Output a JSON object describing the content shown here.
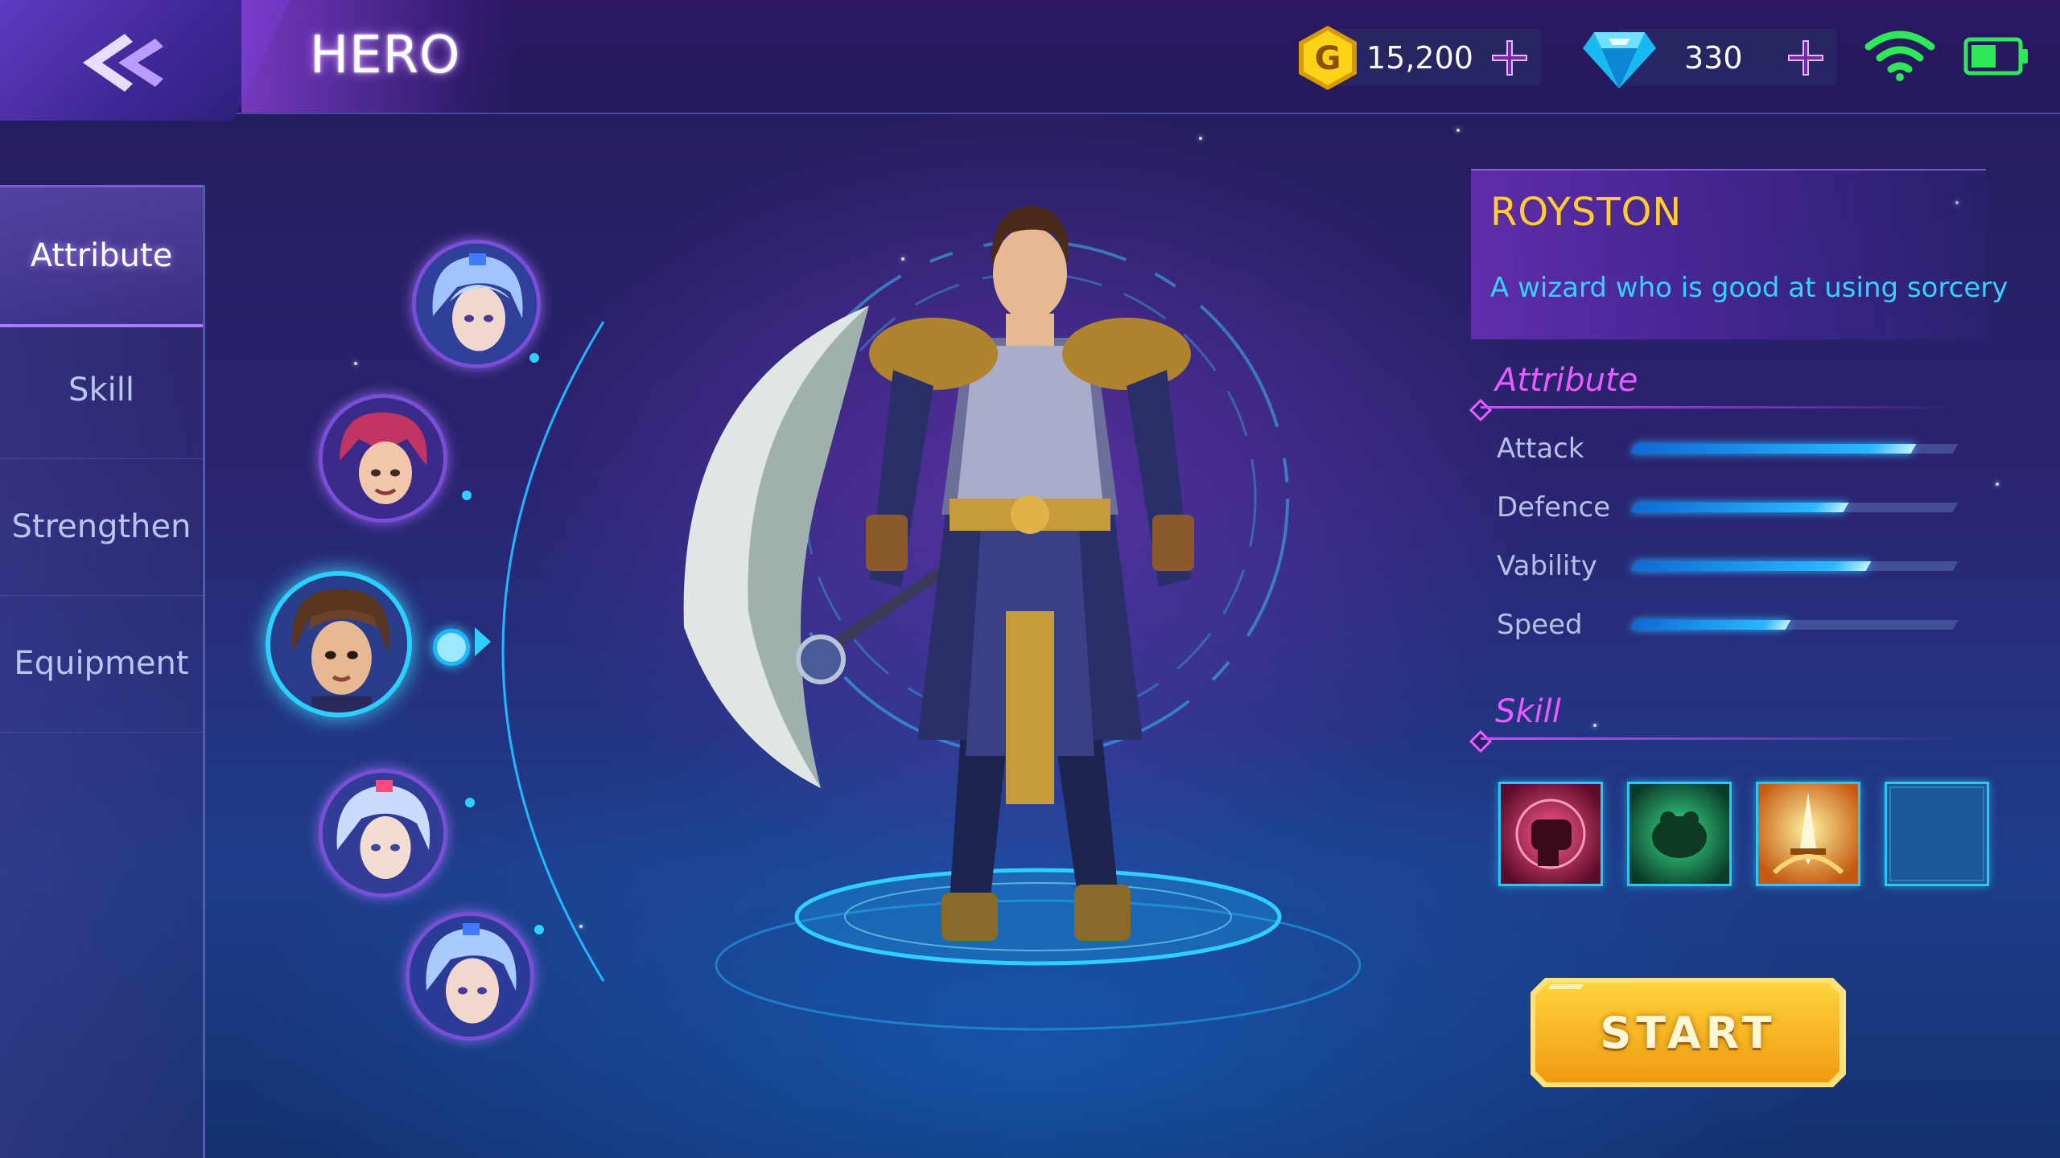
{
  "header": {
    "title": "HERO",
    "gold": "15,200",
    "gems": "330"
  },
  "nav": {
    "items": [
      {
        "label": "Attribute",
        "active": true
      },
      {
        "label": "Skill",
        "active": false
      },
      {
        "label": "Strengthen",
        "active": false
      },
      {
        "label": "Equipment",
        "active": false
      }
    ]
  },
  "hero": {
    "name": "ROYSTON",
    "description": "A wizard who is good at using sorcery"
  },
  "attribute": {
    "title": "Attribute",
    "stats": [
      {
        "label": "Attack",
        "value": 0.87
      },
      {
        "label": "Defence",
        "value": 0.66
      },
      {
        "label": "Vability",
        "value": 0.73
      },
      {
        "label": "Speed",
        "value": 0.48
      }
    ]
  },
  "skill": {
    "title": "Skill",
    "slots": [
      "fist-skill-icon",
      "frog-skill-icon",
      "sword-skill-icon",
      "empty-skill-slot"
    ]
  },
  "start": {
    "label": "START"
  },
  "colors": {
    "accent_gold": "#ffcd2e",
    "accent_cyan": "#33d2ff",
    "accent_magenta": "#e85bff"
  }
}
